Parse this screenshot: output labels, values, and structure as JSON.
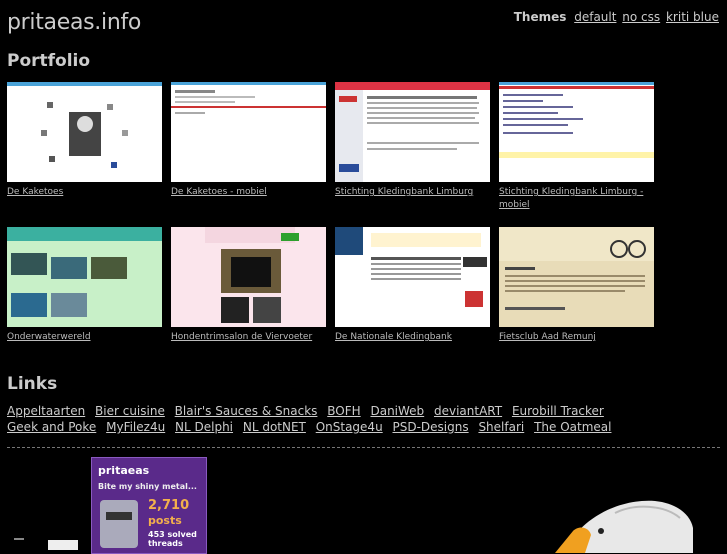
{
  "site": {
    "title": "pritaeas.info"
  },
  "themes": {
    "label": "Themes",
    "options": [
      "default",
      "no css",
      "kriti blue"
    ]
  },
  "portfolio": {
    "heading": "Portfolio",
    "items": [
      {
        "caption": "De Kaketoes"
      },
      {
        "caption": "De Kaketoes - mobiel"
      },
      {
        "caption": "Stichting Kledingbank Limburg"
      },
      {
        "caption": "Stichting Kledingbank Limburg - mobiel"
      },
      {
        "caption": "Onderwaterwereld"
      },
      {
        "caption": "Hondentrimsalon de Viervoeter"
      },
      {
        "caption": "De Nationale Kledingbank"
      },
      {
        "caption": "Fietsclub Aad Remunj"
      }
    ]
  },
  "links": {
    "heading": "Links",
    "items": [
      "Appeltaarten",
      "Bier cuisine",
      "Blair's Sauces & Snacks",
      "BOFH",
      "DaniWeb",
      "deviantART",
      "Eurobill Tracker",
      "Geek and Poke",
      "MyFilez4u",
      "NL Delphi",
      "NL dotNET",
      "OnStage4u",
      "PSD-Designs",
      "Shelfari",
      "The Oatmeal"
    ]
  },
  "badge": {
    "name": "pritaeas",
    "tagline": "Bite my shiny metal...",
    "count": "2,710",
    "posts": "posts",
    "solved": "453 solved",
    "threads": "threads"
  }
}
